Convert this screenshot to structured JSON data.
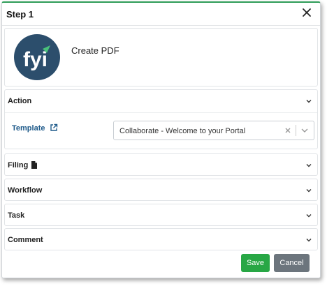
{
  "dialog": {
    "title": "Step 1",
    "close_icon": "close-icon"
  },
  "step": {
    "logo_text": "fyi",
    "name": "Create PDF"
  },
  "sections": {
    "action": {
      "label": "Action"
    },
    "filing": {
      "label": "Filing"
    },
    "workflow": {
      "label": "Workflow"
    },
    "task": {
      "label": "Task"
    },
    "comment": {
      "label": "Comment"
    }
  },
  "template": {
    "label": "Template",
    "value": "Collaborate - Welcome to your Portal"
  },
  "buttons": {
    "save": "Save",
    "cancel": "Cancel"
  },
  "colors": {
    "accent": "#2e9d58",
    "save": "#28a745",
    "cancel": "#6c757d",
    "logo_bg": "#2c4e6c",
    "label_blue": "#1e5a8a"
  }
}
